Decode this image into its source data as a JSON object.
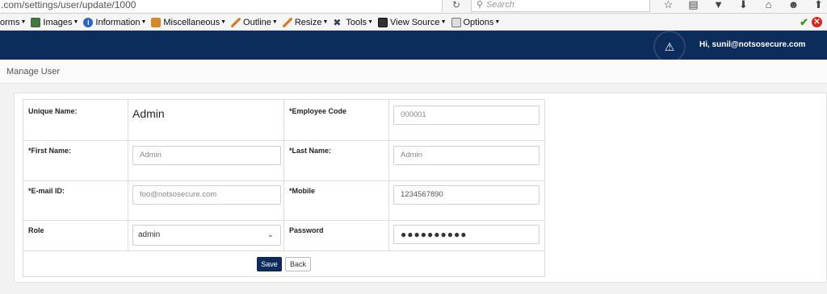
{
  "browser": {
    "url": ".com/settings/user/update/1000",
    "search_placeholder": "Search"
  },
  "devbar": {
    "items": [
      {
        "label": "orms",
        "icon": "forms-icon"
      },
      {
        "label": "Images",
        "icon": "images-icon"
      },
      {
        "label": "Information",
        "icon": "information-icon"
      },
      {
        "label": "Miscellaneous",
        "icon": "miscellaneous-icon"
      },
      {
        "label": "Outline",
        "icon": "outline-icon"
      },
      {
        "label": "Resize",
        "icon": "resize-icon"
      },
      {
        "label": "Tools",
        "icon": "tools-icon"
      },
      {
        "label": "View Source",
        "icon": "view-source-icon"
      },
      {
        "label": "Options",
        "icon": "options-icon"
      }
    ]
  },
  "header": {
    "greeting": "Hi, sunil@notsosecure.com",
    "brand_color": "#0c2c5c"
  },
  "page": {
    "title": "Manage User"
  },
  "form": {
    "unique_name_label": "Unique Name:",
    "unique_name_value": "Admin",
    "employee_code_label": "*Employee Code",
    "employee_code_value": "000001",
    "first_name_label": "*First Name:",
    "first_name_value": "Admin",
    "last_name_label": "*Last Name:",
    "last_name_value": "Admin",
    "email_label": "*E-mail ID:",
    "email_value": "foo@notsosecure.com",
    "mobile_label": "*Mobile",
    "mobile_value": "1234567890",
    "role_label": "Role",
    "role_value": "admin",
    "password_label": "Password",
    "password_value": "●●●●●●●●●●",
    "save_label": "Save",
    "back_label": "Back"
  }
}
